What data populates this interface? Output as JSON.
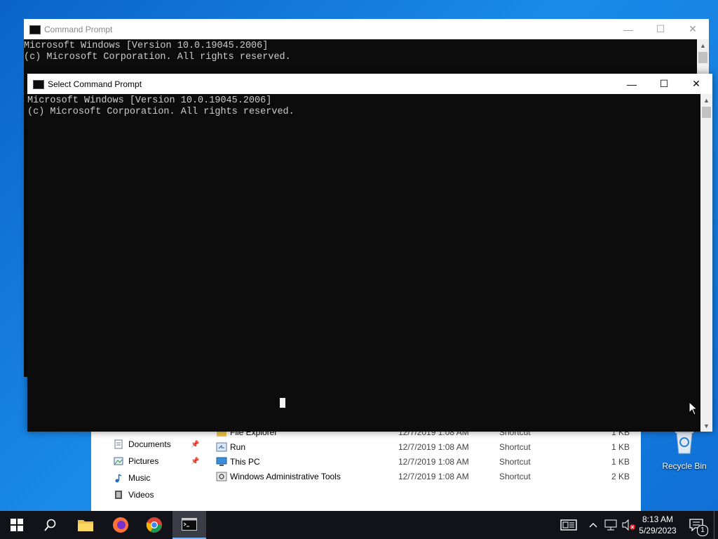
{
  "back_window": {
    "title": "Command Prompt",
    "lines": [
      "Microsoft Windows [Version 10.0.19045.2006]",
      "(c) Microsoft Corporation. All rights reserved."
    ],
    "minimize": "—",
    "maximize": "☐",
    "close": "✕"
  },
  "front_window": {
    "title": "Select Command Prompt",
    "lines": [
      "Microsoft Windows [Version 10.0.19045.2006]",
      "(c) Microsoft Corporation. All rights reserved."
    ],
    "minimize": "—",
    "maximize": "☐",
    "close": "✕"
  },
  "explorer": {
    "nav": [
      {
        "label": "Documents",
        "icon": "documents-icon",
        "pinned": true
      },
      {
        "label": "Pictures",
        "icon": "pictures-icon",
        "pinned": true
      },
      {
        "label": "Music",
        "icon": "music-icon",
        "pinned": false
      },
      {
        "label": "Videos",
        "icon": "videos-icon",
        "pinned": false
      }
    ],
    "files": [
      {
        "name": "File Explorer",
        "date": "12/7/2019 1:08 AM",
        "type": "Shortcut",
        "size": "1 KB"
      },
      {
        "name": "Run",
        "date": "12/7/2019 1:08 AM",
        "type": "Shortcut",
        "size": "1 KB"
      },
      {
        "name": "This PC",
        "date": "12/7/2019 1:08 AM",
        "type": "Shortcut",
        "size": "1 KB"
      },
      {
        "name": "Windows Administrative Tools",
        "date": "12/7/2019 1:08 AM",
        "type": "Shortcut",
        "size": "2 KB"
      }
    ]
  },
  "desktop": {
    "recycle_bin": "Recycle Bin"
  },
  "taskbar": {
    "time": "8:13 AM",
    "date": "5/29/2023",
    "notification_count": "1",
    "apps": [
      "windows-start-icon",
      "search-icon",
      "file-explorer-icon",
      "firefox-icon",
      "chrome-icon",
      "command-prompt-icon"
    ]
  },
  "colors": {
    "accent": "#0078d7",
    "console_bg": "#0c0c0c",
    "console_text": "#cccccc",
    "taskbar": "#111318"
  }
}
